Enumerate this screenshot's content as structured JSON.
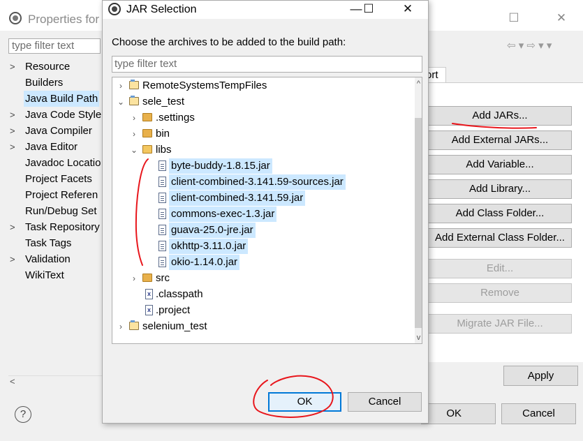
{
  "background_window": {
    "title": "Properties for s",
    "filter_placeholder": "type filter text",
    "min_glyph": "—",
    "max_glyph": "☐",
    "close_glyph": "✕",
    "nav_glyphs": "⇦ ▾ ⇨ ▾ ▾",
    "tree_items": [
      {
        "label": "Resource",
        "expandable": true
      },
      {
        "label": "Builders",
        "expandable": false
      },
      {
        "label": "Java Build Path",
        "expandable": false,
        "selected": true
      },
      {
        "label": "Java Code Style",
        "expandable": true
      },
      {
        "label": "Java Compiler",
        "expandable": true
      },
      {
        "label": "Java Editor",
        "expandable": true
      },
      {
        "label": "Javadoc Locatio",
        "expandable": false
      },
      {
        "label": "Project Facets",
        "expandable": false
      },
      {
        "label": "Project Referen",
        "expandable": false
      },
      {
        "label": "Run/Debug Set",
        "expandable": false
      },
      {
        "label": "Task Repository",
        "expandable": true
      },
      {
        "label": "Task Tags",
        "expandable": false
      },
      {
        "label": "Validation",
        "expandable": true
      },
      {
        "label": "WikiText",
        "expandable": false
      }
    ],
    "tab_fragment": "ort",
    "side_buttons": [
      {
        "label": "Add JARs...",
        "enabled": true
      },
      {
        "label": "Add External JARs...",
        "enabled": true
      },
      {
        "label": "Add Variable...",
        "enabled": true
      },
      {
        "label": "Add Library...",
        "enabled": true
      },
      {
        "label": "Add Class Folder...",
        "enabled": true
      },
      {
        "label": "Add External Class Folder...",
        "enabled": true
      },
      {
        "label": "Edit...",
        "enabled": false
      },
      {
        "label": "Remove",
        "enabled": false
      },
      {
        "label": "Migrate JAR File...",
        "enabled": false
      }
    ],
    "apply_label": "Apply",
    "ok_label": "OK",
    "cancel_label": "Cancel",
    "help_glyph": "?",
    "scroll_left_glyph": "<"
  },
  "dialog": {
    "title": "JAR Selection",
    "min_glyph": "—",
    "max_glyph": "☐",
    "close_glyph": "✕",
    "prompt": "Choose the archives to be added to the build path:",
    "filter_placeholder": "type filter text",
    "tree": [
      {
        "label": "RemoteSystemsTempFiles",
        "kind": "project",
        "chevron": ">",
        "selected": false
      },
      {
        "label": "sele_test",
        "kind": "project",
        "chevron": "v",
        "selected": false
      },
      {
        "label": ".settings",
        "kind": "folder",
        "chevron": ">",
        "selected": false
      },
      {
        "label": "bin",
        "kind": "folder",
        "chevron": ">",
        "selected": false
      },
      {
        "label": "libs",
        "kind": "folder-open",
        "chevron": "v",
        "selected": false
      },
      {
        "label": "byte-buddy-1.8.15.jar",
        "kind": "jar",
        "chevron": "",
        "selected": true
      },
      {
        "label": "client-combined-3.141.59-sources.jar",
        "kind": "jar",
        "chevron": "",
        "selected": true
      },
      {
        "label": "client-combined-3.141.59.jar",
        "kind": "jar",
        "chevron": "",
        "selected": true
      },
      {
        "label": "commons-exec-1.3.jar",
        "kind": "jar",
        "chevron": "",
        "selected": true
      },
      {
        "label": "guava-25.0-jre.jar",
        "kind": "jar",
        "chevron": "",
        "selected": true
      },
      {
        "label": "okhttp-3.11.0.jar",
        "kind": "jar",
        "chevron": "",
        "selected": true
      },
      {
        "label": "okio-1.14.0.jar",
        "kind": "jar",
        "chevron": "",
        "selected": true
      },
      {
        "label": "src",
        "kind": "folder",
        "chevron": ">",
        "selected": false
      },
      {
        "label": ".classpath",
        "kind": "xfile",
        "chevron": "",
        "selected": false
      },
      {
        "label": ".project",
        "kind": "xfile",
        "chevron": "",
        "selected": false
      },
      {
        "label": "selenium_test",
        "kind": "project",
        "chevron": ">",
        "selected": false
      }
    ],
    "ok_label": "OK",
    "cancel_label": "Cancel",
    "scroll_up_glyph": "^",
    "scroll_down_glyph": "v"
  },
  "annotation_color": "#e8161c"
}
